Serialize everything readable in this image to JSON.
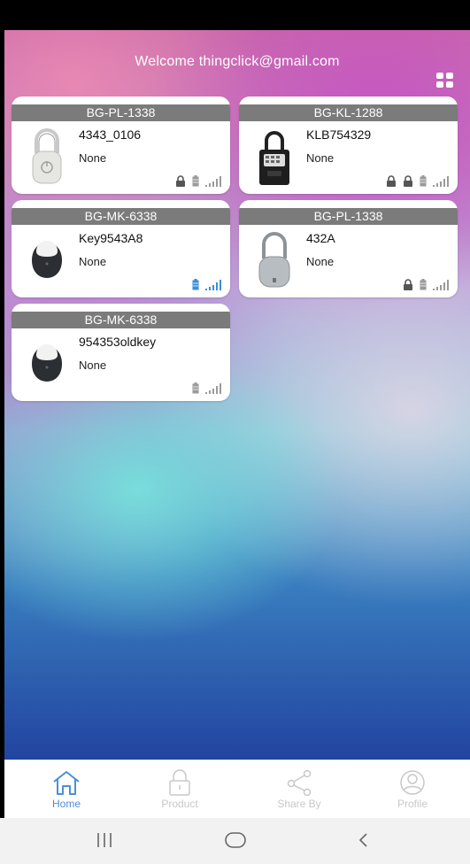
{
  "header": {
    "welcome_text": "Welcome thingclick@gmail.com",
    "view_toggle_icon": "grid-view-icon"
  },
  "devices": [
    {
      "model": "BG-PL-1338",
      "name": "4343_0106",
      "status": "None",
      "image": "padlock-white",
      "icons": [
        "lock-icon",
        "battery-icon",
        "signal-icon"
      ],
      "battery_color": "#9a9a9a",
      "signal_color": "#9a9a9a"
    },
    {
      "model": "BG-KL-1288",
      "name": "KLB754329",
      "status": "None",
      "image": "key-lockbox",
      "icons": [
        "lock-icon",
        "lock-icon",
        "battery-icon",
        "signal-icon"
      ],
      "battery_color": "#9a9a9a",
      "signal_color": "#9a9a9a"
    },
    {
      "model": "BG-MK-6338",
      "name": "Key9543A8",
      "status": "None",
      "image": "key-fob",
      "icons": [
        "battery-icon",
        "signal-icon"
      ],
      "battery_color": "#3a8fd8",
      "signal_color": "#3a8fd8"
    },
    {
      "model": "BG-PL-1338",
      "name": "432A",
      "status": "None",
      "image": "padlock-grey",
      "icons": [
        "lock-icon",
        "battery-icon",
        "signal-icon"
      ],
      "battery_color": "#9a9a9a",
      "signal_color": "#9a9a9a"
    },
    {
      "model": "BG-MK-6338",
      "name": "954353oldkey",
      "status": "None",
      "image": "key-fob",
      "icons": [
        "battery-icon",
        "signal-icon"
      ],
      "battery_color": "#9a9a9a",
      "signal_color": "#9a9a9a"
    }
  ],
  "nav": {
    "home": "Home",
    "product": "Product",
    "share_by": "Share By",
    "profile": "Profile",
    "active_color": "#4c8fd6",
    "inactive_color": "#c8c8c8"
  },
  "system_nav": {
    "recents_icon": "recents-icon",
    "home_icon": "home-circle-icon",
    "back_icon": "back-icon"
  }
}
